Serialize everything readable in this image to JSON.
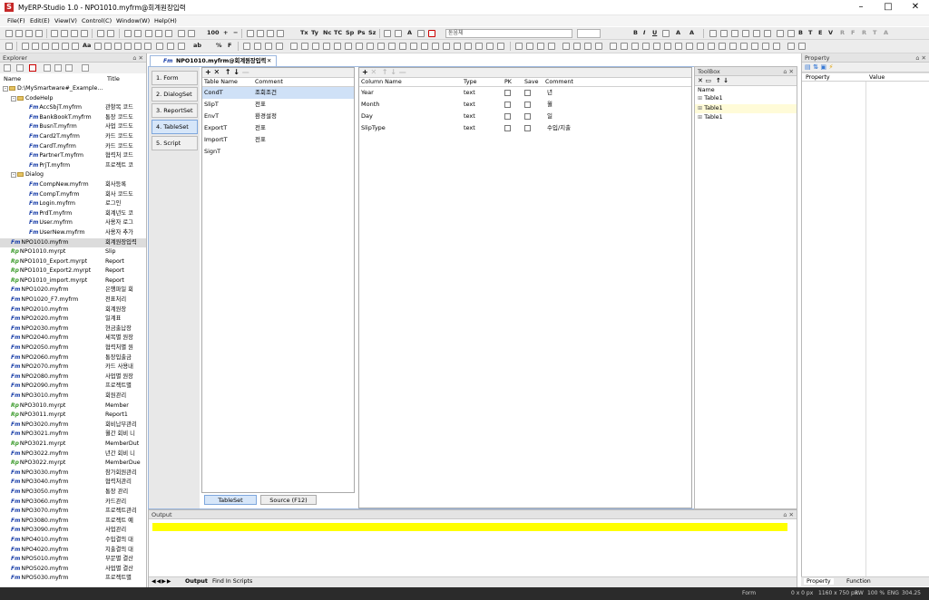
{
  "window": {
    "title": "MyERP-Studio 1.0 - NPO1010.myfrm@회계원장입력",
    "icon": "S"
  },
  "menu": [
    "File(F)",
    "Edit(E)",
    "View(V)",
    "Control(C)",
    "Window(W)",
    "Help(H)"
  ],
  "toolbar": {
    "zoom": "100",
    "font_box": "돋움체",
    "t1": "Tx",
    "t2": "Ty",
    "t3": "Nc",
    "t4": "TC",
    "t5": "Sp",
    "t6": "Ps",
    "t7": "Sz",
    "bold": "B",
    "italic": "I",
    "underline": "U",
    "aa": "Aa",
    "pct": "%",
    "F": "F",
    "abc": "ab"
  },
  "explorer": {
    "title": "Explorer",
    "col_name": "Name",
    "col_title": "Title",
    "root": "D:\\MySmartware#_Example...",
    "items": [
      {
        "t": "folder",
        "n": "CodeHelp",
        "lv": 1
      },
      {
        "t": "fm",
        "n": "AccSbjT.myfrm",
        "ti": "관항목 코드",
        "lv": 2
      },
      {
        "t": "fm",
        "n": "BankBookT.myfrm",
        "ti": "통장 코드도",
        "lv": 2
      },
      {
        "t": "fm",
        "n": "BusnT.myfrm",
        "ti": "사업 코드도",
        "lv": 2
      },
      {
        "t": "fm",
        "n": "Card2T.myfrm",
        "ti": "카드 코드도",
        "lv": 2
      },
      {
        "t": "fm",
        "n": "CardT.myfrm",
        "ti": "카드 코드도",
        "lv": 2
      },
      {
        "t": "fm",
        "n": "PartnerT.myfrm",
        "ti": "협력처 코드",
        "lv": 2
      },
      {
        "t": "fm",
        "n": "PrjT.myfrm",
        "ti": "프로젝트 코",
        "lv": 2
      },
      {
        "t": "folder",
        "n": "Dialog",
        "lv": 1
      },
      {
        "t": "fm",
        "n": "CompNew.myfrm",
        "ti": "회사등록",
        "lv": 2
      },
      {
        "t": "fm",
        "n": "CompT.myfrm",
        "ti": "회사 코드도",
        "lv": 2
      },
      {
        "t": "fm",
        "n": "Login.myfrm",
        "ti": "로그인",
        "lv": 2
      },
      {
        "t": "fm",
        "n": "PrdT.myfrm",
        "ti": "회계년도 코",
        "lv": 2
      },
      {
        "t": "fm",
        "n": "User.myfrm",
        "ti": "사용자 로그",
        "lv": 2
      },
      {
        "t": "fm",
        "n": "UserNew.myfrm",
        "ti": "사용자 추가",
        "lv": 2
      },
      {
        "t": "fm",
        "n": "NPO1010.myfrm",
        "ti": "회계원장입력",
        "lv": 1,
        "sel": true
      },
      {
        "t": "rp",
        "n": "NPO1010.myrpt",
        "ti": "Slip",
        "lv": 1
      },
      {
        "t": "rp",
        "n": "NPO1010_Export.myrpt",
        "ti": "Report",
        "lv": 1
      },
      {
        "t": "rp",
        "n": "NPO1010_Export2.myrpt",
        "ti": "Report",
        "lv": 1
      },
      {
        "t": "rp",
        "n": "NPO1010_import.myrpt",
        "ti": "Report",
        "lv": 1
      },
      {
        "t": "fm",
        "n": "NPO1020.myfrm",
        "ti": "은행파일 회",
        "lv": 1
      },
      {
        "t": "fm",
        "n": "NPO1020_F7.myfrm",
        "ti": "전표처리",
        "lv": 1
      },
      {
        "t": "fm",
        "n": "NPO2010.myfrm",
        "ti": "회계원장",
        "lv": 1
      },
      {
        "t": "fm",
        "n": "NPO2020.myfrm",
        "ti": "일계표",
        "lv": 1
      },
      {
        "t": "fm",
        "n": "NPO2030.myfrm",
        "ti": "현금출납장",
        "lv": 1
      },
      {
        "t": "fm",
        "n": "NPO2040.myfrm",
        "ti": "세목별 원장",
        "lv": 1
      },
      {
        "t": "fm",
        "n": "NPO2050.myfrm",
        "ti": "협력처별 원",
        "lv": 1
      },
      {
        "t": "fm",
        "n": "NPO2060.myfrm",
        "ti": "통장입출금",
        "lv": 1
      },
      {
        "t": "fm",
        "n": "NPO2070.myfrm",
        "ti": "카드 사용내",
        "lv": 1
      },
      {
        "t": "fm",
        "n": "NPO2080.myfrm",
        "ti": "사업별 원장",
        "lv": 1
      },
      {
        "t": "fm",
        "n": "NPO2090.myfrm",
        "ti": "프로젝트별",
        "lv": 1
      },
      {
        "t": "fm",
        "n": "NPO3010.myfrm",
        "ti": "회원관리",
        "lv": 1
      },
      {
        "t": "rp",
        "n": "NPO3010.myrpt",
        "ti": "Member",
        "lv": 1
      },
      {
        "t": "rp",
        "n": "NPO3011.myrpt",
        "ti": "Report1",
        "lv": 1
      },
      {
        "t": "fm",
        "n": "NPO3020.myfrm",
        "ti": "회비납부관리",
        "lv": 1
      },
      {
        "t": "fm",
        "n": "NPO3021.myfrm",
        "ti": "월간 회비 니",
        "lv": 1
      },
      {
        "t": "rp",
        "n": "NPO3021.myrpt",
        "ti": "MemberDut",
        "lv": 1
      },
      {
        "t": "fm",
        "n": "NPO3022.myfrm",
        "ti": "년간 회비 니",
        "lv": 1
      },
      {
        "t": "rp",
        "n": "NPO3022.myrpt",
        "ti": "MemberDue",
        "lv": 1
      },
      {
        "t": "fm",
        "n": "NPO3030.myfrm",
        "ti": "참가회원관리",
        "lv": 1
      },
      {
        "t": "fm",
        "n": "NPO3040.myfrm",
        "ti": "협력처관리",
        "lv": 1
      },
      {
        "t": "fm",
        "n": "NPO3050.myfrm",
        "ti": "통장 관리",
        "lv": 1
      },
      {
        "t": "fm",
        "n": "NPO3060.myfrm",
        "ti": "카드관리",
        "lv": 1
      },
      {
        "t": "fm",
        "n": "NPO3070.myfrm",
        "ti": "프로젝트관리",
        "lv": 1
      },
      {
        "t": "fm",
        "n": "NPO3080.myfrm",
        "ti": "프로젝트 예",
        "lv": 1
      },
      {
        "t": "fm",
        "n": "NPO3090.myfrm",
        "ti": "사업관리",
        "lv": 1
      },
      {
        "t": "fm",
        "n": "NPO4010.myfrm",
        "ti": "수입결의 대",
        "lv": 1
      },
      {
        "t": "fm",
        "n": "NPO4020.myfrm",
        "ti": "지출결의 대",
        "lv": 1
      },
      {
        "t": "fm",
        "n": "NPO5010.myfrm",
        "ti": "부문별 결산",
        "lv": 1
      },
      {
        "t": "fm",
        "n": "NPO5020.myfrm",
        "ti": "사업별 결산",
        "lv": 1
      },
      {
        "t": "fm",
        "n": "NPO5030.myfrm",
        "ti": "프로젝트별",
        "lv": 1
      }
    ]
  },
  "document": {
    "tab_label": "NPO1010.myfrm@회계원장입력",
    "tab_icon": "Fm"
  },
  "nav": [
    "1. Form",
    "2. DialogSet",
    "3. ReportSet",
    "4. TableSet",
    "5. Script"
  ],
  "tables": {
    "header": [
      "Table Name",
      "Comment"
    ],
    "rows": [
      [
        "CondT",
        "조회조건"
      ],
      [
        "SlipT",
        "전표"
      ],
      [
        "EnvT",
        "환경설정"
      ],
      [
        "ExportT",
        "전표"
      ],
      [
        "ImportT",
        "전표"
      ],
      [
        "SignT",
        ""
      ]
    ]
  },
  "columns": {
    "header": [
      "Column Name",
      "Type",
      "PK",
      "Save",
      "Comment"
    ],
    "rows": [
      [
        "Year",
        "text",
        "년"
      ],
      [
        "Month",
        "text",
        "월"
      ],
      [
        "Day",
        "text",
        "일"
      ],
      [
        "SlipType",
        "text",
        "수입/지출"
      ]
    ]
  },
  "bottom_tabs": [
    "TableSet",
    "Source (F12)"
  ],
  "toolbox": {
    "title": "ToolBox",
    "col": "Name",
    "items": [
      "Table1",
      "Table1",
      "Table1"
    ]
  },
  "property": {
    "title": "Property",
    "col1": "Property",
    "col2": "Value"
  },
  "output": {
    "title": "Output",
    "tabs": [
      "Output",
      "Find In Scripts"
    ]
  },
  "bottom_right_tabs": [
    "Property",
    "Function"
  ],
  "status": [
    "Form",
    "0 x 0 px",
    "1160 x 750 px",
    "RW",
    "100 %",
    "ENG",
    "304.25"
  ],
  "colors": {
    "highlight": "#ffff00",
    "selection": "#cfe1f7"
  }
}
